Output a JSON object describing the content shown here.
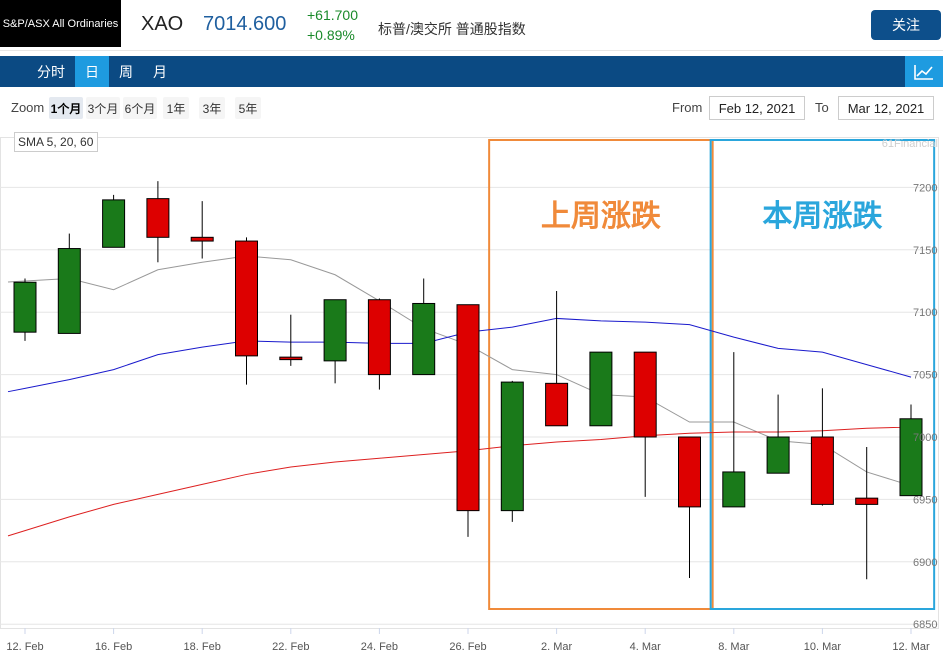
{
  "header": {
    "logo_text": "S&P/ASX All Ordinaries",
    "ticker": "XAO",
    "price": "7014.600",
    "change": "+61.700",
    "change_pct": "+0.89%",
    "description": "标普/澳交所 普通股指数",
    "follow_label": "关注"
  },
  "nav": {
    "tabs": [
      "分时",
      "日",
      "周",
      "月"
    ],
    "active": "日",
    "chart_icon": "line-chart-icon"
  },
  "zoom": {
    "label": "Zoom",
    "options": [
      "1个月",
      "3个月",
      "6个月",
      "1年",
      "3年",
      "5年"
    ],
    "selected": "1个月",
    "from_label": "From",
    "from_value": "Feb 12, 2021",
    "to_label": "To",
    "to_value": "Mar 12, 2021"
  },
  "annotations": {
    "last_week": "上周涨跌",
    "this_week": "本周涨跌"
  },
  "colors": {
    "up": "#1a7a1a",
    "down": "#dd0000",
    "sma5": "#999999",
    "sma20": "#1a1acc",
    "sma60": "#dd2020",
    "last_week_box": "#f08a3a",
    "this_week_box": "#2aa6dc",
    "nav_bg": "#0b4a83",
    "nav_active": "#1e9be0"
  },
  "chart_data": {
    "type": "candlestick",
    "indicator_label": "SMA 5, 20, 60",
    "watermark": "61Financial",
    "ylim": [
      6850,
      7230
    ],
    "y_ticks": [
      6850,
      6900,
      6950,
      7000,
      7050,
      7100,
      7150,
      7200
    ],
    "y_tick_labels": [
      "6850",
      "6900",
      "6950",
      "7000",
      "7050",
      "7100",
      "7150",
      "7200"
    ],
    "x_ticks": [
      {
        "index": 0,
        "label": "12. Feb"
      },
      {
        "index": 2,
        "label": "16. Feb"
      },
      {
        "index": 4,
        "label": "18. Feb"
      },
      {
        "index": 6,
        "label": "22. Feb"
      },
      {
        "index": 8,
        "label": "24. Feb"
      },
      {
        "index": 10,
        "label": "26. Feb"
      },
      {
        "index": 12,
        "label": "2. Mar"
      },
      {
        "index": 14,
        "label": "4. Mar"
      },
      {
        "index": 16,
        "label": "8. Mar"
      },
      {
        "index": 18,
        "label": "10. Mar"
      },
      {
        "index": 20,
        "label": "12. Mar"
      }
    ],
    "candles": [
      {
        "date": "Feb 12",
        "open": 7084,
        "high": 7127,
        "low": 7077,
        "close": 7124
      },
      {
        "date": "Feb 15",
        "open": 7083,
        "high": 7163,
        "low": 7083,
        "close": 7151
      },
      {
        "date": "Feb 16",
        "open": 7152,
        "high": 7194,
        "low": 7152,
        "close": 7190
      },
      {
        "date": "Feb 17",
        "open": 7191,
        "high": 7205,
        "low": 7140,
        "close": 7160
      },
      {
        "date": "Feb 18",
        "open": 7160,
        "high": 7189,
        "low": 7143,
        "close": 7157
      },
      {
        "date": "Feb 19",
        "open": 7157,
        "high": 7160,
        "low": 7042,
        "close": 7065
      },
      {
        "date": "Feb 22",
        "open": 7064,
        "high": 7098,
        "low": 7057,
        "close": 7062
      },
      {
        "date": "Feb 23",
        "open": 7061,
        "high": 7110,
        "low": 7043,
        "close": 7110
      },
      {
        "date": "Feb 24",
        "open": 7110,
        "high": 7111,
        "low": 7038,
        "close": 7050
      },
      {
        "date": "Feb 25",
        "open": 7050,
        "high": 7127,
        "low": 7050,
        "close": 7107
      },
      {
        "date": "Feb 26",
        "open": 7106,
        "high": 7106,
        "low": 6920,
        "close": 6941
      },
      {
        "date": "Mar 1",
        "open": 6941,
        "high": 7045,
        "low": 6932,
        "close": 7044
      },
      {
        "date": "Mar 2",
        "open": 7043,
        "high": 7117,
        "low": 7009,
        "close": 7009
      },
      {
        "date": "Mar 3",
        "open": 7009,
        "high": 7068,
        "low": 7009,
        "close": 7068
      },
      {
        "date": "Mar 4",
        "open": 7068,
        "high": 7068,
        "low": 6952,
        "close": 7000
      },
      {
        "date": "Mar 5",
        "open": 7000,
        "high": 7000,
        "low": 6887,
        "close": 6944
      },
      {
        "date": "Mar 8",
        "open": 6944,
        "high": 7068,
        "low": 6944,
        "close": 6972
      },
      {
        "date": "Mar 9",
        "open": 6971,
        "high": 7034,
        "low": 6971,
        "close": 7000
      },
      {
        "date": "Mar 10",
        "open": 7000,
        "high": 7039,
        "low": 6945,
        "close": 6946
      },
      {
        "date": "Mar 11",
        "open": 6951,
        "high": 6992,
        "low": 6886,
        "close": 6946
      },
      {
        "date": "Mar 12",
        "open": 6953,
        "high": 7026,
        "low": 6953,
        "close": 7014.6
      }
    ],
    "series": [
      {
        "name": "SMA 5",
        "values": [
          7125,
          7127,
          7118,
          7134,
          7140,
          7145,
          7142,
          7130,
          7109,
          7087,
          7074,
          7054,
          7050,
          7034,
          7032,
          7012,
          7012,
          6997,
          6994,
          6972,
          6961
        ]
      },
      {
        "name": "SMA 20",
        "values": [
          7039,
          7046,
          7054,
          7066,
          7072,
          7077,
          7076,
          7076,
          7075,
          7075,
          7084,
          7088,
          7095,
          7093,
          7092,
          7090,
          7080,
          7071,
          7068,
          7058,
          7048
        ]
      },
      {
        "name": "SMA 60",
        "values": [
          6925,
          6936,
          6946,
          6954,
          6962,
          6970,
          6976,
          6980,
          6983,
          6986,
          6989,
          6993,
          6996,
          6998,
          7001,
          7003,
          7004,
          7004,
          7005,
          7007,
          7008
        ]
      }
    ],
    "highlight_boxes": [
      {
        "label": "上周涨跌",
        "from_index": 11,
        "to_index": 15
      },
      {
        "label": "本周涨跌",
        "from_index": 16,
        "to_index": 20
      }
    ]
  }
}
